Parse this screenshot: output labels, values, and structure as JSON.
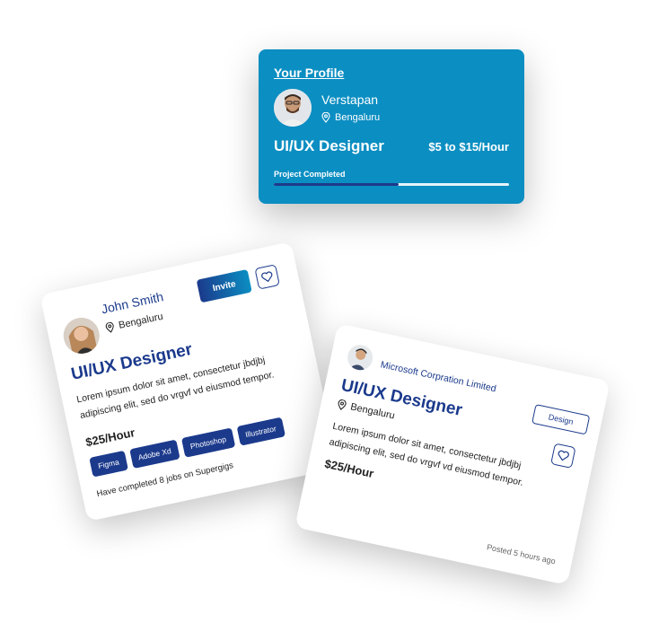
{
  "profile": {
    "title": "Your Profile",
    "name": "Verstapan",
    "location": "Bengaluru",
    "role": "UI/UX Designer",
    "rate": "$5 to $15/Hour",
    "progress_label": "Project Completed",
    "progress_fraction": 0.53
  },
  "freelancer": {
    "name": "John Smith",
    "location": "Bengaluru",
    "invite_label": "Invite",
    "role": "UI/UX Designer",
    "description": "Lorem ipsum dolor sit amet, consectetur jbdjbj adipiscing elit, sed do vrgvf vd eiusmod tempor.",
    "price": "$25/Hour",
    "tags": [
      "Figma",
      "Adobe Xd",
      "Photoshop",
      "Illustrator"
    ],
    "footnote": "Have completed 8 jobs on Supergigs"
  },
  "job": {
    "company": "Microsoft Corpration Limited",
    "category_label": "Design",
    "role": "UI/UX Designer",
    "location": "Bengaluru",
    "description": "Lorem ipsum dolor sit amet, consectetur jbdjbj adipiscing elit, sed do vrgvf vd eiusmod tempor.",
    "price": "$25/Hour",
    "posted": "Posted 5 hours ago"
  },
  "icons": {
    "location": "location-pin-icon",
    "favorite": "heart-icon"
  },
  "colors": {
    "profile_bg": "#0b8ec2",
    "navy": "#1b3a8c",
    "progress_fill": "#1e3a8a"
  }
}
